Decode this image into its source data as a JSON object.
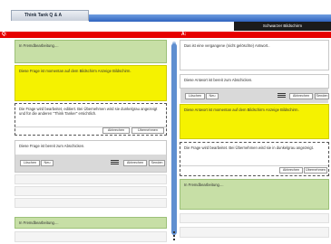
{
  "window": {
    "tab_title": "Think Tank Q & A"
  },
  "toolbar": {
    "blackout_button": "Schwarzer Bildschirm"
  },
  "headers": {
    "left": "Q:",
    "right": "A:"
  },
  "left": {
    "card1": "In Fremdbearbeitung....",
    "card2": "Diese Frage ist momentan auf dem Bildschirm Anzeige Bildschirm.",
    "card3": "Die Frage wird bearbeitet, editiert. Bei Übernehmen wird sie dunkelgrau angezeigt und für die anderen \"Think Tanker\" ersichtlich.",
    "card3_cancel": "Abbrechen",
    "card3_accept": "Übernehmen",
    "card4": "Diese Frage ist bereit zum Abschicken.",
    "card4_delete": "Löschen",
    "card4_new": "Neu",
    "card4_cancel": "Abbrechen",
    "card4_send": "Senden",
    "card5": "In Fremdbearbeitung...."
  },
  "right": {
    "card1": "Das ist eine vergangene (nicht gelöschte) Antwort..",
    "card2": "Diese Antwort ist bereit zum Abschicken.",
    "card2_delete": "Löschen",
    "card2_new": "Neu",
    "card2_cancel": "Abbrechen",
    "card2_send": "Senden",
    "card3": "Diese Antwort ist momentan auf dem Bildschirm Anzeige Bildschirm.",
    "card4": "Die Frage wird bearbeitet. Bei Übernehmen wird sie in dunkelgrau angezeigt.",
    "card4_cancel": "Abbrechen",
    "card4_accept": "Übernehmen",
    "card5": "In Fremdbearbeitung...."
  }
}
